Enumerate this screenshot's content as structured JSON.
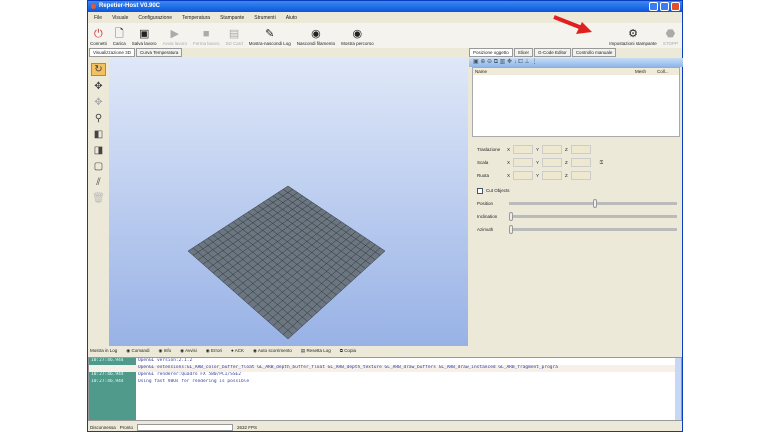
{
  "window": {
    "title": "Repetier-Host V0.90C"
  },
  "menu": [
    "File",
    "Visuale",
    "Configurazione",
    "Temperatura",
    "Stampante",
    "Strumenti",
    "Aiuto"
  ],
  "toolbar": {
    "connect": "Connetti",
    "load": "Carica",
    "save": "Salva lavoro",
    "run": "Avvia lavoro",
    "stop": "Ferma lavoro",
    "sdcard": "SD Card",
    "log": "Mostra-nascondi Log",
    "filament": "Nascondi filamento",
    "path": "Mostra percorso",
    "printer_settings": "Impostazioni stampante",
    "estop": "STOPP"
  },
  "left_tabs": [
    "Visualizzazione 3D",
    "Curva Temperatura"
  ],
  "right_tabs": [
    "Posizione oggetto",
    "Slicer",
    "G-Code Editor",
    "Controllo manuale"
  ],
  "object_table": {
    "columns": [
      "Name",
      "Mesh",
      "Coll..."
    ]
  },
  "transform": {
    "rows": [
      "Traslazione",
      "Scala",
      "Ruota"
    ],
    "axes": [
      "X",
      "Y",
      "Z"
    ]
  },
  "cut": {
    "label": "Cut Objects",
    "sliders": [
      "Position",
      "Inclination",
      "Azimuth"
    ]
  },
  "log": {
    "filters": [
      "Mostra in Log",
      "Comandi",
      "Info",
      "Avvisi",
      "Errori",
      "ACK",
      "Auto scorrimento",
      "Resetta Log",
      "Copia"
    ],
    "lines": [
      {
        "time": "10:27:46.944",
        "msg": "OpenGL version:2.1.2"
      },
      {
        "time": "10:27:46.944",
        "msg": "OpenGL extensions:GL_ARB_color_buffer_float GL_ARB_depth_buffer_float GL_ARB_depth_texture GL_ARB_draw_buffers GL_ARB_draw_instanced GL_ARB_fragment_progra"
      },
      {
        "time": "10:27:46.944",
        "msg": "OpenGL renderer:Quadro FX 580/PCI/SSE2"
      },
      {
        "time": "10:27:46.944",
        "msg": "Using fast VBOs for rendering is possible"
      }
    ]
  },
  "status": {
    "connection": "Disconnessa",
    "state": "Pronto",
    "fps": "2632 FPS"
  }
}
